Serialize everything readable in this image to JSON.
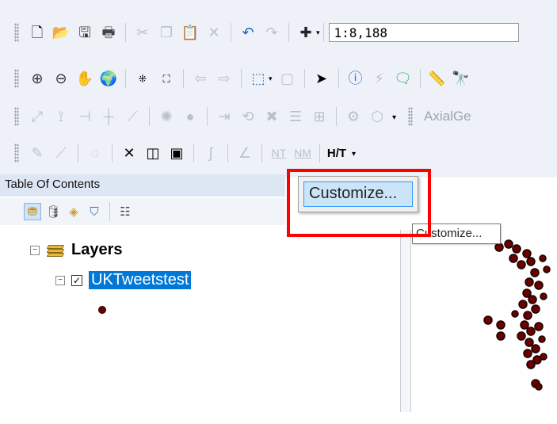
{
  "toolbar": {
    "scale_value": "1:8,188",
    "axial_label": "AxialGe",
    "row1_icons": [
      "new-document-icon",
      "open-folder-icon",
      "save-icon",
      "print-icon",
      "cut-icon",
      "copy-icon",
      "paste-icon",
      "delete-icon",
      "undo-icon",
      "redo-icon",
      "add-data-icon"
    ],
    "row4_labels": {
      "nt": "NT",
      "nm": "NM",
      "ht": "H/T"
    }
  },
  "toc": {
    "header_title": "Table Of Contents",
    "root_label": "Layers",
    "layer_name": "UKTweetstest"
  },
  "context_menu": {
    "item_label": "Customize..."
  },
  "tooltip": {
    "text": "Customize..."
  },
  "colors": {
    "highlight": "#ff0000",
    "selection": "#0078d7",
    "point_symbol": "#6b0000",
    "menu_hover": "#cce4f7"
  }
}
